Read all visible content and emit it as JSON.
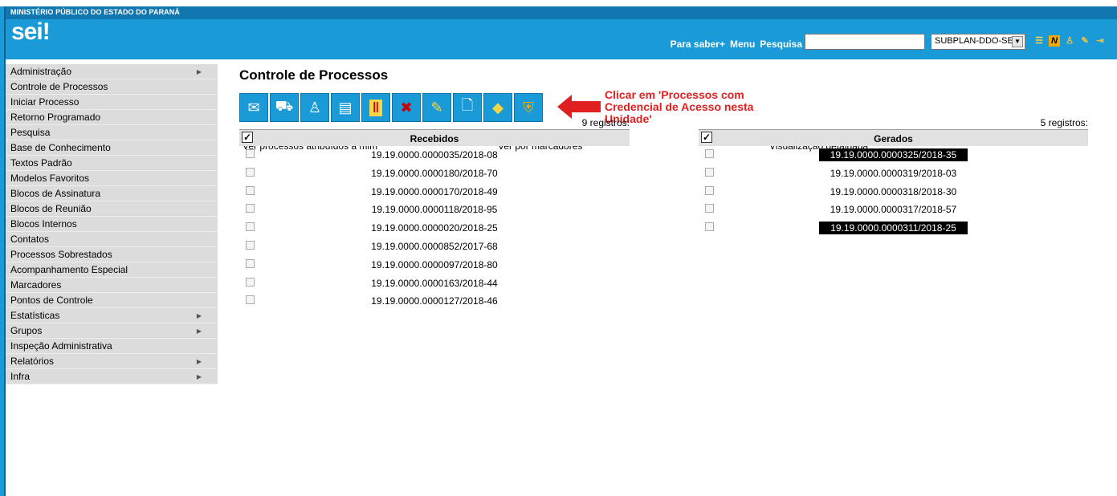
{
  "header": {
    "org_name": "MINISTÉRIO PÚBLICO DO ESTADO DO PARANÁ",
    "logo": "sei",
    "logo_suffix": "!",
    "links": [
      "Para saber+",
      "Menu",
      "Pesquisa"
    ],
    "search_value": "",
    "unit_selected": "SUBPLAN-DDO-SEI",
    "icons": [
      "list-icon",
      "notes-icon",
      "user-icon",
      "tools-icon",
      "exit-icon"
    ]
  },
  "menu": {
    "items": [
      {
        "label": "Administração",
        "submenu": true
      },
      {
        "label": "Controle de Processos",
        "submenu": false
      },
      {
        "label": "Iniciar Processo",
        "submenu": false
      },
      {
        "label": "Retorno Programado",
        "submenu": false
      },
      {
        "label": "Pesquisa",
        "submenu": false
      },
      {
        "label": "Base de Conhecimento",
        "submenu": false
      },
      {
        "label": "Textos Padrão",
        "submenu": false
      },
      {
        "label": "Modelos Favoritos",
        "submenu": false
      },
      {
        "label": "Blocos de Assinatura",
        "submenu": false
      },
      {
        "label": "Blocos de Reunião",
        "submenu": false
      },
      {
        "label": "Blocos Internos",
        "submenu": false
      },
      {
        "label": "Contatos",
        "submenu": false
      },
      {
        "label": "Processos Sobrestados",
        "submenu": false
      },
      {
        "label": "Acompanhamento Especial",
        "submenu": false
      },
      {
        "label": "Marcadores",
        "submenu": false
      },
      {
        "label": "Pontos de Controle",
        "submenu": false
      },
      {
        "label": "Estatísticas",
        "submenu": true
      },
      {
        "label": "Grupos",
        "submenu": true
      },
      {
        "label": "Inspeção Administrativa",
        "submenu": false
      },
      {
        "label": "Relatórios",
        "submenu": true
      },
      {
        "label": "Infra",
        "submenu": true
      }
    ]
  },
  "main": {
    "title": "Controle de Processos",
    "toolbar": [
      {
        "icon": "envelope-icon"
      },
      {
        "icon": "send-process-icon"
      },
      {
        "icon": "assign-person-icon"
      },
      {
        "icon": "books-icon"
      },
      {
        "icon": "pause-icon"
      },
      {
        "icon": "remove-folder-icon"
      },
      {
        "icon": "notes-clip-icon"
      },
      {
        "icon": "new-document-icon"
      },
      {
        "icon": "tag-icon"
      },
      {
        "icon": "credential-shield-icon"
      }
    ],
    "annotation": "Clicar em 'Processos com Credencial de Acesso nesta Unidade'",
    "filters": {
      "assigned": "Ver processos atribuídos a mim",
      "markers": "Ver por marcadores",
      "detailed": "Visualização detalhada"
    },
    "received": {
      "count": "9 registros:",
      "header": "Recebidos",
      "rows": [
        {
          "id": "19.19.0000.0000035/2018-08",
          "highlight": false
        },
        {
          "id": "19.19.0000.0000180/2018-70",
          "highlight": false
        },
        {
          "id": "19.19.0000.0000170/2018-49",
          "highlight": false
        },
        {
          "id": "19.19.0000.0000118/2018-95",
          "highlight": false
        },
        {
          "id": "19.19.0000.0000020/2018-25",
          "highlight": false
        },
        {
          "id": "19.19.0000.0000852/2017-68",
          "highlight": false
        },
        {
          "id": "19.19.0000.0000097/2018-80",
          "highlight": false
        },
        {
          "id": "19.19.0000.0000163/2018-44",
          "highlight": false
        },
        {
          "id": "19.19.0000.0000127/2018-46",
          "highlight": false
        }
      ]
    },
    "generated": {
      "count": "5 registros:",
      "header": "Gerados",
      "rows": [
        {
          "id": "19.19.0000.0000325/2018-35",
          "highlight": true
        },
        {
          "id": "19.19.0000.0000319/2018-03",
          "highlight": false
        },
        {
          "id": "19.19.0000.0000318/2018-30",
          "highlight": false
        },
        {
          "id": "19.19.0000.0000317/2018-57",
          "highlight": false
        },
        {
          "id": "19.19.0000.0000311/2018-25",
          "highlight": true
        }
      ]
    }
  },
  "colors": {
    "header_blue": "#1a9ad6",
    "header_dark": "#1177b0",
    "annotation_red": "#e02020",
    "menu_bg": "#dcdcdc"
  }
}
